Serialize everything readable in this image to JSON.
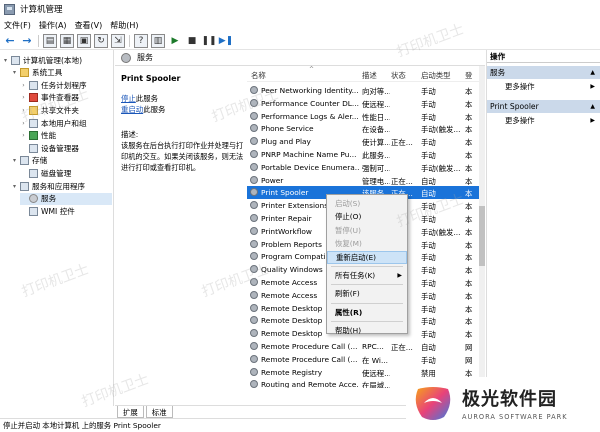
{
  "window": {
    "title": "计算机管理"
  },
  "menubar": [
    "文件(F)",
    "操作(A)",
    "查看(V)",
    "帮助(H)"
  ],
  "tree": [
    {
      "label": "计算机管理(本地)",
      "level": 0,
      "expander": "▾",
      "icon": "computer-icon"
    },
    {
      "label": "系统工具",
      "level": 1,
      "expander": "▾",
      "icon": "tools-icon"
    },
    {
      "label": "任务计划程序",
      "level": 2,
      "expander": "›",
      "icon": "clock-icon"
    },
    {
      "label": "事件查看器",
      "level": 2,
      "expander": "›",
      "icon": "event-icon"
    },
    {
      "label": "共享文件夹",
      "level": 2,
      "expander": "›",
      "icon": "folder-icon"
    },
    {
      "label": "本地用户和组",
      "level": 2,
      "expander": "›",
      "icon": "users-icon"
    },
    {
      "label": "性能",
      "level": 2,
      "expander": "›",
      "icon": "performance-icon"
    },
    {
      "label": "设备管理器",
      "level": 2,
      "expander": "",
      "icon": "device-icon"
    },
    {
      "label": "存储",
      "level": 1,
      "expander": "▾",
      "icon": "storage-icon"
    },
    {
      "label": "磁盘管理",
      "level": 2,
      "expander": "",
      "icon": "disk-icon"
    },
    {
      "label": "服务和应用程序",
      "level": 1,
      "expander": "▾",
      "icon": "apps-icon"
    },
    {
      "label": "服务",
      "level": 2,
      "expander": "",
      "icon": "gear-icon",
      "selected": true
    },
    {
      "label": "WMI 控件",
      "level": 2,
      "expander": "",
      "icon": "wmi-icon"
    }
  ],
  "center": {
    "header": "服务",
    "desc": {
      "title": "Print Spooler",
      "stop_link": "停止",
      "stop_rest": "此服务",
      "restart_link": "重启动",
      "restart_rest": "此服务",
      "desc_label": "描述:",
      "desc_text": "该服务在后台执行打印作业并处理与打印机的交互。如果关闭该服务，则无法进行打印或查看打印机。"
    },
    "columns": {
      "name": "名称",
      "desc": "描述",
      "status": "状态",
      "startup": "启动类型",
      "logon": "登"
    },
    "rows": [
      {
        "name": "Peer Networking Identity...",
        "desc": "向对等...",
        "status": "",
        "startup": "手动",
        "logon": "本"
      },
      {
        "name": "Performance Counter DL...",
        "desc": "使远程...",
        "status": "",
        "startup": "手动",
        "logon": "本"
      },
      {
        "name": "Performance Logs & Aler...",
        "desc": "性能日...",
        "status": "",
        "startup": "手动",
        "logon": "本"
      },
      {
        "name": "Phone Service",
        "desc": "在设备...",
        "status": "",
        "startup": "手动(触发...",
        "logon": "本"
      },
      {
        "name": "Plug and Play",
        "desc": "使计算...",
        "status": "正在...",
        "startup": "手动",
        "logon": "本"
      },
      {
        "name": "PNRP Machine Name Pu...",
        "desc": "此服务...",
        "status": "",
        "startup": "手动",
        "logon": "本"
      },
      {
        "name": "Portable Device Enumera...",
        "desc": "强制可...",
        "status": "",
        "startup": "手动(触发...",
        "logon": "本"
      },
      {
        "name": "Power",
        "desc": "管理电...",
        "status": "正在...",
        "startup": "自动",
        "logon": "本"
      },
      {
        "name": "Print Spooler",
        "desc": "该服务...",
        "status": "正在...",
        "startup": "自动",
        "logon": "本",
        "selected": true
      },
      {
        "name": "Printer Extensions",
        "desc": "",
        "status": "",
        "startup": "手动",
        "logon": "本"
      },
      {
        "name": "Printer Repair",
        "desc": "",
        "status": "",
        "startup": "手动",
        "logon": "本"
      },
      {
        "name": "PrintWorkflow",
        "desc": "",
        "status": "",
        "startup": "手动(触发...",
        "logon": "本"
      },
      {
        "name": "Problem Reports",
        "desc": "",
        "status": "",
        "startup": "手动",
        "logon": "本"
      },
      {
        "name": "Program Compatibility",
        "desc": "",
        "status": "",
        "startup": "手动",
        "logon": "本"
      },
      {
        "name": "Quality Windows",
        "desc": "",
        "status": "",
        "startup": "手动",
        "logon": "本"
      },
      {
        "name": "Remote Access",
        "desc": "",
        "status": "",
        "startup": "手动",
        "logon": "本"
      },
      {
        "name": "Remote Access",
        "desc": "",
        "status": "",
        "startup": "手动",
        "logon": "本"
      },
      {
        "name": "Remote Desktop",
        "desc": "",
        "status": "",
        "startup": "手动",
        "logon": "本"
      },
      {
        "name": "Remote Desktop",
        "desc": "",
        "status": "",
        "startup": "手动",
        "logon": "本"
      },
      {
        "name": "Remote Desktop",
        "desc": "",
        "status": "",
        "startup": "手动",
        "logon": "本"
      },
      {
        "name": "Remote Procedure Call (...",
        "desc": "RPC...",
        "status": "正在...",
        "startup": "自动",
        "logon": "网"
      },
      {
        "name": "Remote Procedure Call (...",
        "desc": "在 Wi...",
        "status": "",
        "startup": "手动",
        "logon": "网"
      },
      {
        "name": "Remote Registry",
        "desc": "使远程...",
        "status": "",
        "startup": "禁用",
        "logon": "本"
      },
      {
        "name": "Routing and Remote Acce...",
        "desc": "在局域...",
        "status": "",
        "startup": "禁用",
        "logon": "本"
      }
    ],
    "tabs": [
      "扩展",
      "标准"
    ]
  },
  "context_menu": [
    {
      "label": "启动(S)",
      "disabled": true
    },
    {
      "label": "停止(O)"
    },
    {
      "label": "暂停(U)",
      "disabled": true
    },
    {
      "label": "恢复(M)",
      "disabled": true
    },
    {
      "label": "重新启动(E)",
      "highlight": true
    },
    {
      "sep": true
    },
    {
      "label": "所有任务(K)",
      "submenu": true
    },
    {
      "sep": true
    },
    {
      "label": "刷新(F)"
    },
    {
      "sep": true
    },
    {
      "label": "属性(R)",
      "bold": true
    },
    {
      "sep": true
    },
    {
      "label": "帮助(H)"
    }
  ],
  "actions": {
    "title": "操作",
    "sec1": "服务",
    "sec1_item": "更多操作",
    "sec2": "Print Spooler",
    "sec2_item": "更多操作"
  },
  "status_text": "停止并启动 本地计算机 上的服务 Print Spooler",
  "watermark": "打印机卫士",
  "logo": {
    "main": "极光软件园",
    "sub": "AURORA SOFTWARE PARK"
  },
  "colors": {
    "selection": "#1a73d9",
    "section": "#cbd9ea",
    "link": "#1a56b8"
  }
}
